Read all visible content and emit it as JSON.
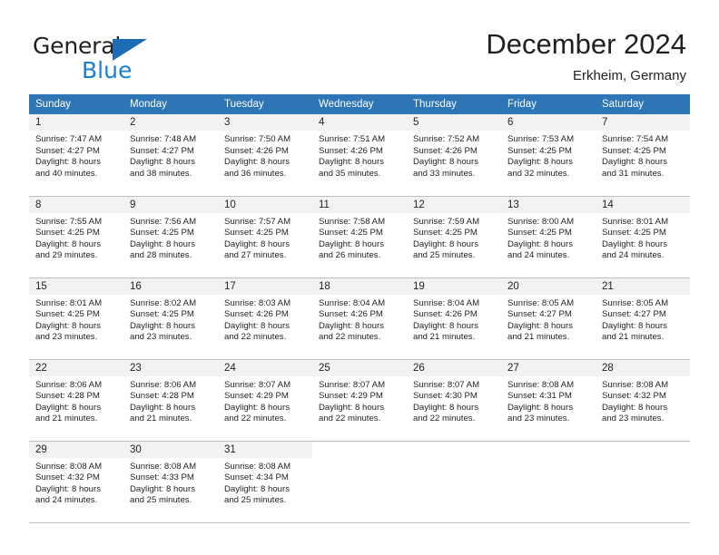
{
  "brand": {
    "name_part1": "General",
    "name_part2": "Blue",
    "logo_icon": "triangle-flag-icon",
    "accent_color": "#1b7fd4",
    "triangle_color": "#1b6cb5"
  },
  "header": {
    "title": "December 2024",
    "subtitle": "Erkheim, Germany"
  },
  "calendar": {
    "header_bg": "#2e75b6",
    "daynum_bg": "#f2f2f2",
    "weekday_headers": [
      "Sunday",
      "Monday",
      "Tuesday",
      "Wednesday",
      "Thursday",
      "Friday",
      "Saturday"
    ],
    "weeks": [
      [
        {
          "day": "1",
          "sunrise": "Sunrise: 7:47 AM",
          "sunset": "Sunset: 4:27 PM",
          "daylight_line1": "Daylight: 8 hours",
          "daylight_line2": "and 40 minutes."
        },
        {
          "day": "2",
          "sunrise": "Sunrise: 7:48 AM",
          "sunset": "Sunset: 4:27 PM",
          "daylight_line1": "Daylight: 8 hours",
          "daylight_line2": "and 38 minutes."
        },
        {
          "day": "3",
          "sunrise": "Sunrise: 7:50 AM",
          "sunset": "Sunset: 4:26 PM",
          "daylight_line1": "Daylight: 8 hours",
          "daylight_line2": "and 36 minutes."
        },
        {
          "day": "4",
          "sunrise": "Sunrise: 7:51 AM",
          "sunset": "Sunset: 4:26 PM",
          "daylight_line1": "Daylight: 8 hours",
          "daylight_line2": "and 35 minutes."
        },
        {
          "day": "5",
          "sunrise": "Sunrise: 7:52 AM",
          "sunset": "Sunset: 4:26 PM",
          "daylight_line1": "Daylight: 8 hours",
          "daylight_line2": "and 33 minutes."
        },
        {
          "day": "6",
          "sunrise": "Sunrise: 7:53 AM",
          "sunset": "Sunset: 4:25 PM",
          "daylight_line1": "Daylight: 8 hours",
          "daylight_line2": "and 32 minutes."
        },
        {
          "day": "7",
          "sunrise": "Sunrise: 7:54 AM",
          "sunset": "Sunset: 4:25 PM",
          "daylight_line1": "Daylight: 8 hours",
          "daylight_line2": "and 31 minutes."
        }
      ],
      [
        {
          "day": "8",
          "sunrise": "Sunrise: 7:55 AM",
          "sunset": "Sunset: 4:25 PM",
          "daylight_line1": "Daylight: 8 hours",
          "daylight_line2": "and 29 minutes."
        },
        {
          "day": "9",
          "sunrise": "Sunrise: 7:56 AM",
          "sunset": "Sunset: 4:25 PM",
          "daylight_line1": "Daylight: 8 hours",
          "daylight_line2": "and 28 minutes."
        },
        {
          "day": "10",
          "sunrise": "Sunrise: 7:57 AM",
          "sunset": "Sunset: 4:25 PM",
          "daylight_line1": "Daylight: 8 hours",
          "daylight_line2": "and 27 minutes."
        },
        {
          "day": "11",
          "sunrise": "Sunrise: 7:58 AM",
          "sunset": "Sunset: 4:25 PM",
          "daylight_line1": "Daylight: 8 hours",
          "daylight_line2": "and 26 minutes."
        },
        {
          "day": "12",
          "sunrise": "Sunrise: 7:59 AM",
          "sunset": "Sunset: 4:25 PM",
          "daylight_line1": "Daylight: 8 hours",
          "daylight_line2": "and 25 minutes."
        },
        {
          "day": "13",
          "sunrise": "Sunrise: 8:00 AM",
          "sunset": "Sunset: 4:25 PM",
          "daylight_line1": "Daylight: 8 hours",
          "daylight_line2": "and 24 minutes."
        },
        {
          "day": "14",
          "sunrise": "Sunrise: 8:01 AM",
          "sunset": "Sunset: 4:25 PM",
          "daylight_line1": "Daylight: 8 hours",
          "daylight_line2": "and 24 minutes."
        }
      ],
      [
        {
          "day": "15",
          "sunrise": "Sunrise: 8:01 AM",
          "sunset": "Sunset: 4:25 PM",
          "daylight_line1": "Daylight: 8 hours",
          "daylight_line2": "and 23 minutes."
        },
        {
          "day": "16",
          "sunrise": "Sunrise: 8:02 AM",
          "sunset": "Sunset: 4:25 PM",
          "daylight_line1": "Daylight: 8 hours",
          "daylight_line2": "and 23 minutes."
        },
        {
          "day": "17",
          "sunrise": "Sunrise: 8:03 AM",
          "sunset": "Sunset: 4:26 PM",
          "daylight_line1": "Daylight: 8 hours",
          "daylight_line2": "and 22 minutes."
        },
        {
          "day": "18",
          "sunrise": "Sunrise: 8:04 AM",
          "sunset": "Sunset: 4:26 PM",
          "daylight_line1": "Daylight: 8 hours",
          "daylight_line2": "and 22 minutes."
        },
        {
          "day": "19",
          "sunrise": "Sunrise: 8:04 AM",
          "sunset": "Sunset: 4:26 PM",
          "daylight_line1": "Daylight: 8 hours",
          "daylight_line2": "and 21 minutes."
        },
        {
          "day": "20",
          "sunrise": "Sunrise: 8:05 AM",
          "sunset": "Sunset: 4:27 PM",
          "daylight_line1": "Daylight: 8 hours",
          "daylight_line2": "and 21 minutes."
        },
        {
          "day": "21",
          "sunrise": "Sunrise: 8:05 AM",
          "sunset": "Sunset: 4:27 PM",
          "daylight_line1": "Daylight: 8 hours",
          "daylight_line2": "and 21 minutes."
        }
      ],
      [
        {
          "day": "22",
          "sunrise": "Sunrise: 8:06 AM",
          "sunset": "Sunset: 4:28 PM",
          "daylight_line1": "Daylight: 8 hours",
          "daylight_line2": "and 21 minutes."
        },
        {
          "day": "23",
          "sunrise": "Sunrise: 8:06 AM",
          "sunset": "Sunset: 4:28 PM",
          "daylight_line1": "Daylight: 8 hours",
          "daylight_line2": "and 21 minutes."
        },
        {
          "day": "24",
          "sunrise": "Sunrise: 8:07 AM",
          "sunset": "Sunset: 4:29 PM",
          "daylight_line1": "Daylight: 8 hours",
          "daylight_line2": "and 22 minutes."
        },
        {
          "day": "25",
          "sunrise": "Sunrise: 8:07 AM",
          "sunset": "Sunset: 4:29 PM",
          "daylight_line1": "Daylight: 8 hours",
          "daylight_line2": "and 22 minutes."
        },
        {
          "day": "26",
          "sunrise": "Sunrise: 8:07 AM",
          "sunset": "Sunset: 4:30 PM",
          "daylight_line1": "Daylight: 8 hours",
          "daylight_line2": "and 22 minutes."
        },
        {
          "day": "27",
          "sunrise": "Sunrise: 8:08 AM",
          "sunset": "Sunset: 4:31 PM",
          "daylight_line1": "Daylight: 8 hours",
          "daylight_line2": "and 23 minutes."
        },
        {
          "day": "28",
          "sunrise": "Sunrise: 8:08 AM",
          "sunset": "Sunset: 4:32 PM",
          "daylight_line1": "Daylight: 8 hours",
          "daylight_line2": "and 23 minutes."
        }
      ],
      [
        {
          "day": "29",
          "sunrise": "Sunrise: 8:08 AM",
          "sunset": "Sunset: 4:32 PM",
          "daylight_line1": "Daylight: 8 hours",
          "daylight_line2": "and 24 minutes."
        },
        {
          "day": "30",
          "sunrise": "Sunrise: 8:08 AM",
          "sunset": "Sunset: 4:33 PM",
          "daylight_line1": "Daylight: 8 hours",
          "daylight_line2": "and 25 minutes."
        },
        {
          "day": "31",
          "sunrise": "Sunrise: 8:08 AM",
          "sunset": "Sunset: 4:34 PM",
          "daylight_line1": "Daylight: 8 hours",
          "daylight_line2": "and 25 minutes."
        },
        {
          "day": "",
          "sunrise": "",
          "sunset": "",
          "daylight_line1": "",
          "daylight_line2": ""
        },
        {
          "day": "",
          "sunrise": "",
          "sunset": "",
          "daylight_line1": "",
          "daylight_line2": ""
        },
        {
          "day": "",
          "sunrise": "",
          "sunset": "",
          "daylight_line1": "",
          "daylight_line2": ""
        },
        {
          "day": "",
          "sunrise": "",
          "sunset": "",
          "daylight_line1": "",
          "daylight_line2": ""
        }
      ]
    ]
  }
}
